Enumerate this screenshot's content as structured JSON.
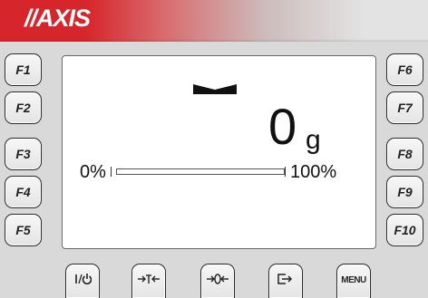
{
  "brand": {
    "logo_text": "//AXIS",
    "accent_color": "#d6262b"
  },
  "function_keys_left": [
    {
      "label": "F1"
    },
    {
      "label": "F2"
    },
    {
      "label": "F3"
    },
    {
      "label": "F4"
    },
    {
      "label": "F5"
    }
  ],
  "function_keys_right": [
    {
      "label": "F6"
    },
    {
      "label": "F7"
    },
    {
      "label": "F8"
    },
    {
      "label": "F9"
    },
    {
      "label": "F10"
    }
  ],
  "display": {
    "weight_value": "0",
    "unit": "g",
    "bargraph": {
      "min_label": "0%",
      "max_label": "100%",
      "fill_fraction": 0.0
    },
    "stable_indicator": "stability-mark-icon"
  },
  "bottom_keys": [
    {
      "name": "power-key",
      "icon": "power-icon"
    },
    {
      "name": "tare-key",
      "icon": "tare-icon"
    },
    {
      "name": "zero-key",
      "icon": "zero-icon"
    },
    {
      "name": "print-key",
      "icon": "print-icon"
    },
    {
      "name": "menu-key",
      "label": "MENU"
    }
  ]
}
